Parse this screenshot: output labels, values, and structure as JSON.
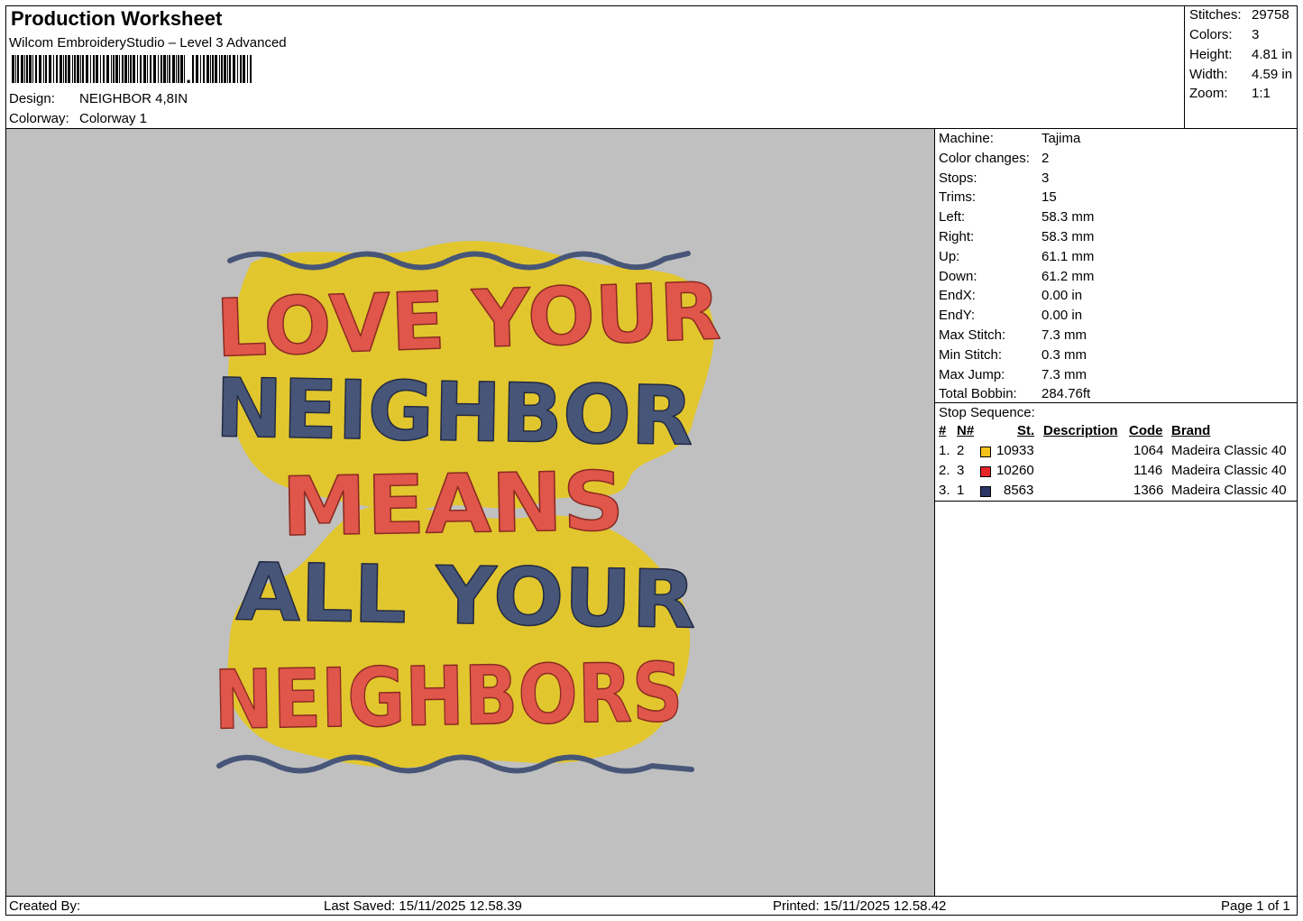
{
  "header": {
    "title": "Production Worksheet",
    "software": "Wilcom EmbroideryStudio – Level 3 Advanced",
    "design_label": "Design:",
    "design_value": "NEIGHBOR 4,8IN",
    "colorway_label": "Colorway:",
    "colorway_value": "Colorway 1"
  },
  "stats": [
    {
      "label": "Stitches:",
      "value": "29758"
    },
    {
      "label": "Colors:",
      "value": "3"
    },
    {
      "label": "Height:",
      "value": "4.81 in"
    },
    {
      "label": "Width:",
      "value": "4.59 in"
    },
    {
      "label": "Zoom:",
      "value": "1:1"
    }
  ],
  "machine_info": [
    {
      "label": "Machine:",
      "value": "Tajima"
    },
    {
      "label": "Color changes:",
      "value": "2"
    },
    {
      "label": "Stops:",
      "value": "3"
    },
    {
      "label": "Trims:",
      "value": "15"
    },
    {
      "label": "Left:",
      "value": "58.3 mm"
    },
    {
      "label": "Right:",
      "value": "58.3 mm"
    },
    {
      "label": "Up:",
      "value": "61.1 mm"
    },
    {
      "label": "Down:",
      "value": "61.2 mm"
    },
    {
      "label": "EndX:",
      "value": "0.00 in"
    },
    {
      "label": "EndY:",
      "value": "0.00 in"
    },
    {
      "label": "Max Stitch:",
      "value": "7.3 mm"
    },
    {
      "label": "Min Stitch:",
      "value": "0.3 mm"
    },
    {
      "label": "Max Jump:",
      "value": "7.3 mm"
    },
    {
      "label": "Total Bobbin:",
      "value": "284.76ft"
    }
  ],
  "stop_sequence": {
    "title": "Stop Sequence:",
    "headers": {
      "num": "#",
      "n": "N#",
      "st": "St.",
      "description": "Description",
      "code": "Code",
      "brand": "Brand"
    },
    "rows": [
      {
        "num": "1.",
        "n": "2",
        "color": "#f5c21b",
        "st": "10933",
        "code": "1064",
        "brand": "Madeira Classic 40"
      },
      {
        "num": "2.",
        "n": "3",
        "color": "#e8262a",
        "st": "10260",
        "code": "1146",
        "brand": "Madeira Classic 40"
      },
      {
        "num": "3.",
        "n": "1",
        "color": "#2b3566",
        "st": "8563",
        "code": "1366",
        "brand": "Madeira Classic 40"
      }
    ]
  },
  "design_text": [
    "LOVE YOUR",
    "NEIGHBOR",
    "MEANS",
    "ALL YOUR",
    "NEIGHBORS"
  ],
  "design_colors": {
    "background": "#c0c0c0",
    "fill": "#e2c62e",
    "red": "#e0564a",
    "navy": "#475678"
  },
  "footer": {
    "created_by": "Created By:",
    "last_saved": "Last Saved: 15/11/2025 12.58.39",
    "printed": "Printed: 15/11/2025 12.58.42",
    "page": "Page 1 of 1"
  }
}
